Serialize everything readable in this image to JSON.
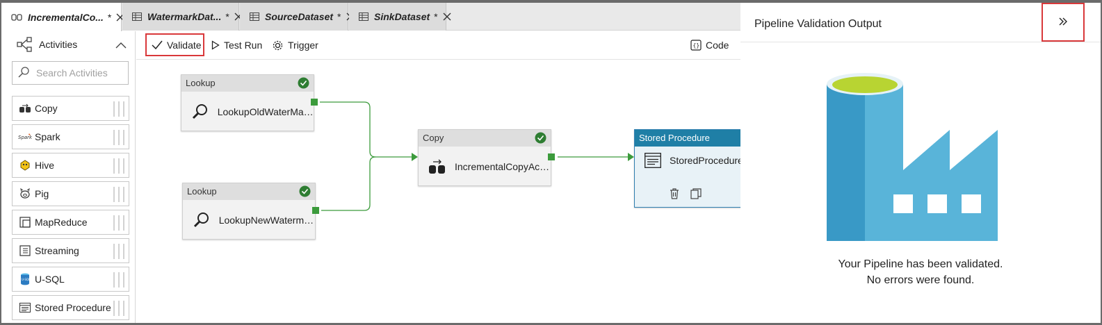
{
  "tabs": [
    {
      "label": "IncrementalCo...",
      "dirty": "*",
      "icon": "pipeline-icon",
      "active": true
    },
    {
      "label": "WatermarkDat...",
      "dirty": "*",
      "icon": "table-icon",
      "active": false
    },
    {
      "label": "SourceDataset",
      "dirty": "*",
      "icon": "table-icon",
      "active": false
    },
    {
      "label": "SinkDataset",
      "dirty": "*",
      "icon": "table-icon",
      "active": false
    }
  ],
  "activities": {
    "title": "Activities",
    "search_placeholder": "Search Activities",
    "items": [
      {
        "label": "Copy",
        "icon": "copy-activity-icon"
      },
      {
        "label": "Spark",
        "icon": "spark-icon"
      },
      {
        "label": "Hive",
        "icon": "hive-icon"
      },
      {
        "label": "Pig",
        "icon": "pig-icon"
      },
      {
        "label": "MapReduce",
        "icon": "mapreduce-icon"
      },
      {
        "label": "Streaming",
        "icon": "streaming-icon"
      },
      {
        "label": "U-SQL",
        "icon": "usql-icon"
      },
      {
        "label": "Stored Procedure",
        "icon": "stored-procedure-icon"
      }
    ]
  },
  "toolbar": {
    "validate_label": "Validate",
    "test_run_label": "Test Run",
    "trigger_label": "Trigger",
    "code_label": "Code"
  },
  "canvas": {
    "nodes": [
      {
        "type": "Lookup",
        "label": "LookupOldWaterMark..."
      },
      {
        "type": "Lookup",
        "label": "LookupNewWatermar..."
      },
      {
        "type": "Copy",
        "label": "IncrementalCopyActiv..."
      },
      {
        "type": "Stored Procedure",
        "label": "StoredProcedure"
      }
    ]
  },
  "validation_panel": {
    "title": "Pipeline Validation Output",
    "message_line1": "Your Pipeline has been validated.",
    "message_line2": "No errors were found."
  },
  "colors": {
    "accent_red": "#d9383a",
    "success_green": "#2e7d32",
    "connector_green": "#3c9b3c",
    "stored_proc_header": "#1f7fa6",
    "factory_blue": "#59b4d9",
    "factory_dark_blue": "#3999c6",
    "factory_top_green": "#b8d432"
  }
}
